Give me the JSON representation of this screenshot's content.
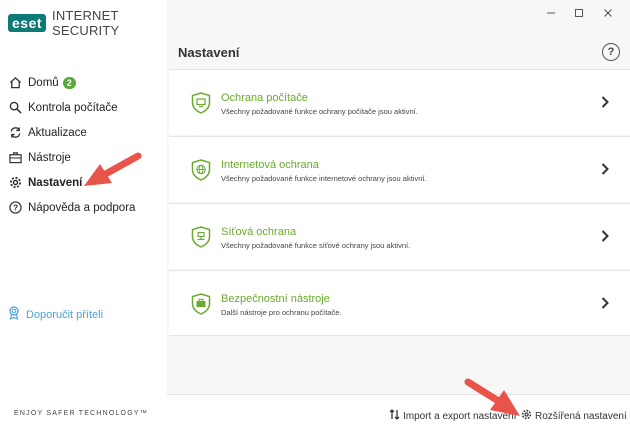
{
  "app": {
    "logo": "eset",
    "title": "INTERNET SECURITY"
  },
  "sidebar": {
    "items": [
      {
        "label": "Domů",
        "badge": "2",
        "icon": "home-icon"
      },
      {
        "label": "Kontrola počítače",
        "icon": "search-icon"
      },
      {
        "label": "Aktualizace",
        "icon": "refresh-icon"
      },
      {
        "label": "Nástroje",
        "icon": "briefcase-icon"
      },
      {
        "label": "Nastavení",
        "icon": "gear-icon",
        "active": true
      },
      {
        "label": "Nápověda a podpora",
        "icon": "help-icon"
      }
    ],
    "recommend": "Doporučit příteli",
    "tagline": "ENJOY SAFER TECHNOLOGY™"
  },
  "main": {
    "title": "Nastavení",
    "cards": [
      {
        "title": "Ochrana počítače",
        "desc": "Všechny požadované funkce ochrany počítače jsou aktivní.",
        "icon": "computer-shield-icon"
      },
      {
        "title": "Internetová ochrana",
        "desc": "Všechny požadované funkce internetové ochrany jsou aktivní.",
        "icon": "globe-shield-icon"
      },
      {
        "title": "Síťová ochrana",
        "desc": "Všechny požadované funkce síťové ochrany jsou aktivní.",
        "icon": "network-shield-icon"
      },
      {
        "title": "Bezpečnostní nástroje",
        "desc": "Další nástroje pro ochranu počítače.",
        "icon": "toolbox-shield-icon"
      }
    ],
    "bottom": {
      "import_export": "Import a export nastavení",
      "advanced": "Rozšířená nastavení"
    }
  },
  "colors": {
    "accent_green": "#6aaa2c",
    "brand_teal": "#0d7a77",
    "arrow_red": "#e8534a",
    "link_blue": "#4ba4d3"
  }
}
